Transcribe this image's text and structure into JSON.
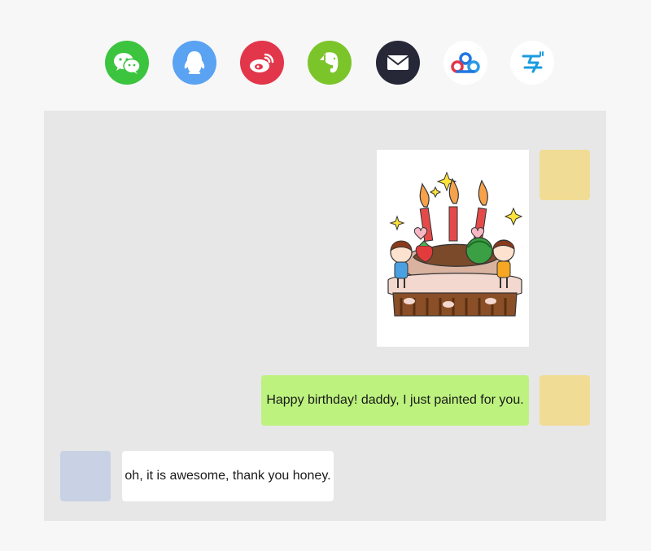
{
  "share_bar": {
    "items": [
      {
        "name": "wechat",
        "icon": "wechat-icon",
        "color": "#3cc43f"
      },
      {
        "name": "qq",
        "icon": "qq-penguin-icon",
        "color": "#5aa2f2"
      },
      {
        "name": "weibo",
        "icon": "weibo-icon",
        "color": "#e2364a"
      },
      {
        "name": "evernote",
        "icon": "evernote-elephant-icon",
        "color": "#7bc52b"
      },
      {
        "name": "email",
        "icon": "envelope-icon",
        "color": "#262838"
      },
      {
        "name": "baidu-cloud",
        "icon": "baidu-cloud-icon",
        "color": "#ffffff"
      },
      {
        "name": "alipay",
        "icon": "alipay-icon",
        "color": "#ffffff"
      }
    ]
  },
  "chat": {
    "background": "#e7e7e7",
    "messages": [
      {
        "sender": "self",
        "type": "image",
        "content": "birthday-cake-drawing",
        "avatar_color": "#f0dc95"
      },
      {
        "sender": "self",
        "type": "text",
        "text": "Happy birthday! daddy, I just painted for you.",
        "bubble_color": "#bdf27f",
        "avatar_color": "#f0dc95"
      },
      {
        "sender": "other",
        "type": "text",
        "text": "oh, it is awesome, thank you honey.",
        "bubble_color": "#ffffff",
        "avatar_color": "#c8d2e4"
      }
    ]
  }
}
